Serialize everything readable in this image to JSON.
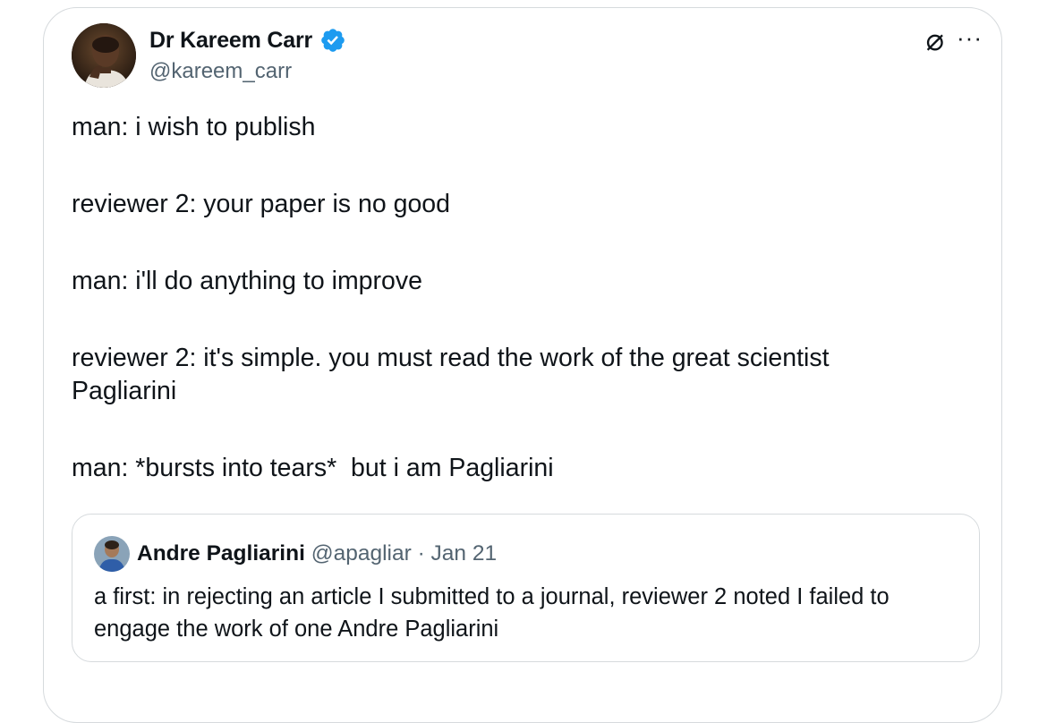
{
  "author": {
    "display_name": "Dr Kareem Carr",
    "handle": "@kareem_carr",
    "verified_color": "#1d9bf0"
  },
  "header_icons": {
    "grok_icon": "slashed-circle-icon",
    "grok_glyph": "⌀",
    "more_icon": "more-icon",
    "more_glyph": "···"
  },
  "tweet": {
    "lines": [
      "man: i wish to publish",
      "reviewer 2: your paper is no good",
      "man: i'll do anything to improve",
      "reviewer 2: it's simple. you must read the work of the great scientist Pagliarini",
      "man: *bursts into tears*  but i am Pagliarini"
    ]
  },
  "quoted_tweet": {
    "display_name": "Andre Pagliarini",
    "handle": "@apagliar",
    "separator": "·",
    "date": "Jan 21",
    "text": "a first: in rejecting an article I submitted to a journal, reviewer 2 noted I failed to engage the work of one Andre Pagliarini"
  },
  "colors": {
    "text": "#0f1419",
    "secondary": "#536471",
    "border": "#d6dadd"
  }
}
